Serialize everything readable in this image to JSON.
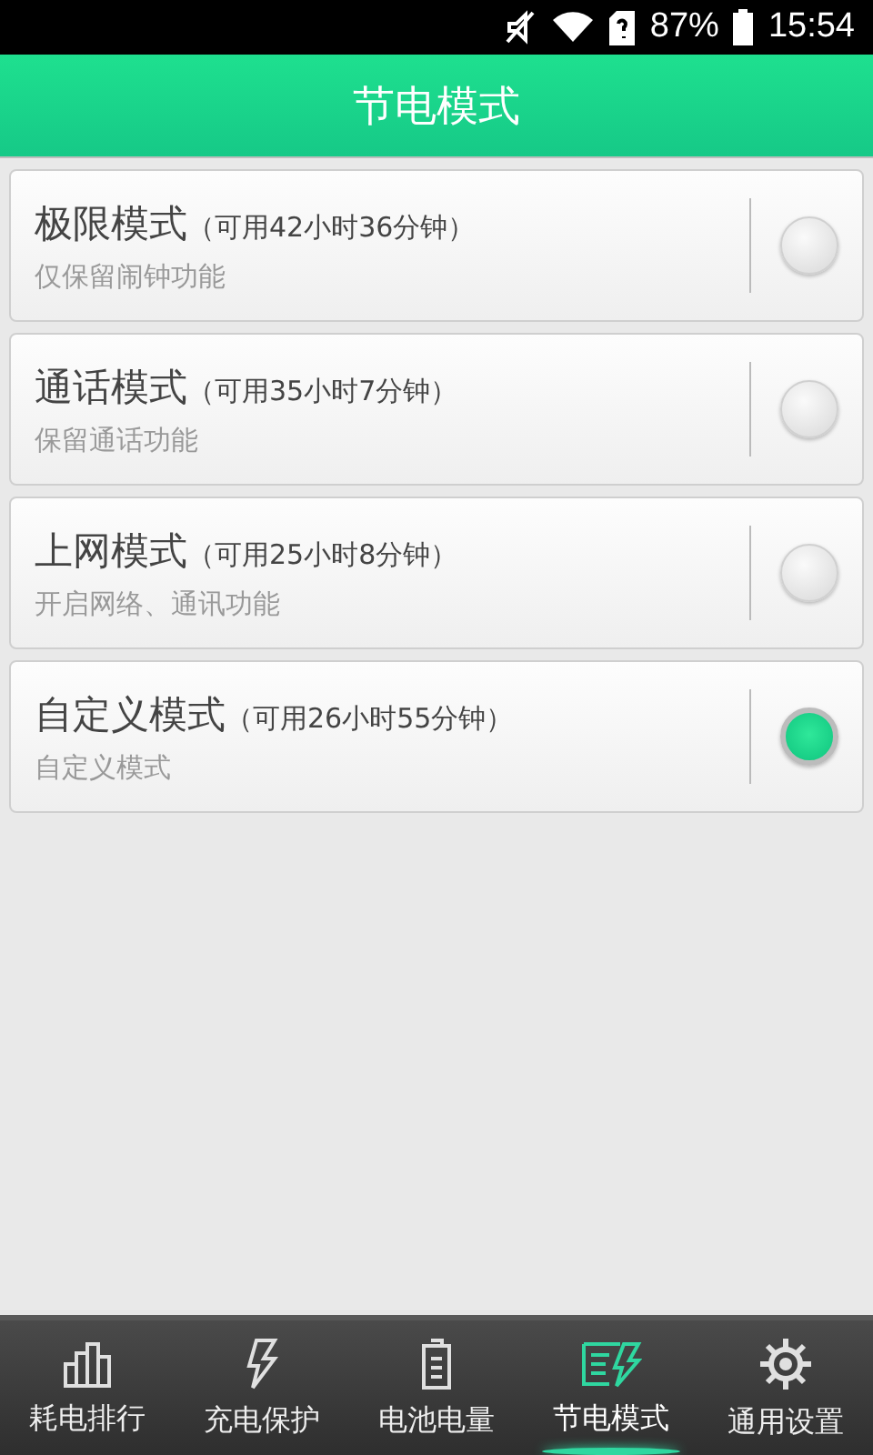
{
  "status_bar": {
    "battery_percent": "87%",
    "time": "15:54"
  },
  "header": {
    "title": "节电模式"
  },
  "modes": [
    {
      "name": "极限模式",
      "availability": "（可用42小时36分钟）",
      "description": "仅保留闹钟功能",
      "selected": false
    },
    {
      "name": "通话模式",
      "availability": "（可用35小时7分钟）",
      "description": "保留通话功能",
      "selected": false
    },
    {
      "name": "上网模式",
      "availability": "（可用25小时8分钟）",
      "description": "开启网络、通讯功能",
      "selected": false
    },
    {
      "name": "自定义模式",
      "availability": "（可用26小时55分钟）",
      "description": "自定义模式",
      "selected": true
    }
  ],
  "tabs": [
    {
      "label": "耗电排行",
      "selected": false
    },
    {
      "label": "充电保护",
      "selected": false
    },
    {
      "label": "电池电量",
      "selected": false
    },
    {
      "label": "节电模式",
      "selected": true
    },
    {
      "label": "通用设置",
      "selected": false
    }
  ]
}
